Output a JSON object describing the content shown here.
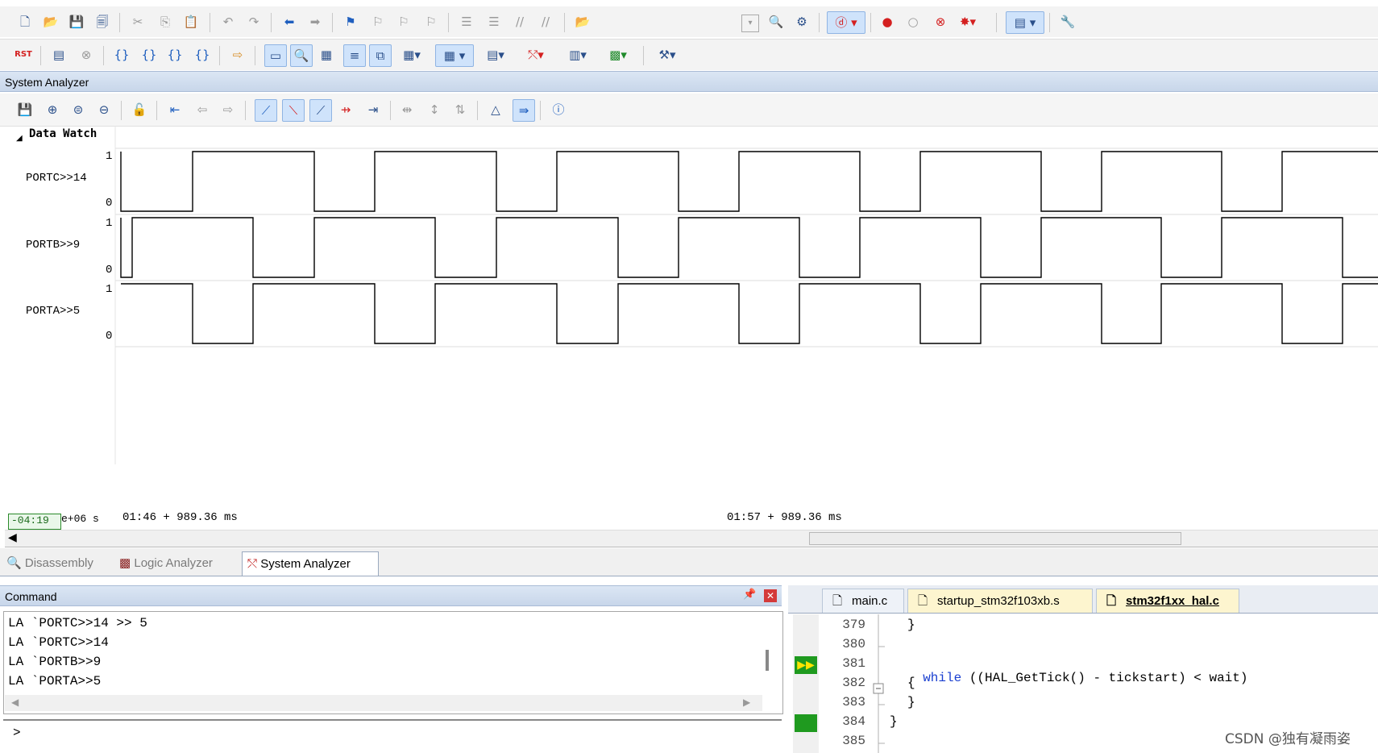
{
  "analyzer": {
    "panel_title": "System Analyzer",
    "group_label": "Data Watch",
    "signals": [
      {
        "name": "PORTC>>14",
        "high_label": "1",
        "low_label": "0"
      },
      {
        "name": "PORTB>>9",
        "high_label": "1",
        "low_label": "0"
      },
      {
        "name": "PORTA>>5",
        "high_label": "1",
        "low_label": "0"
      }
    ],
    "status": {
      "cursor_time": "-04:19",
      "scale": "e+06 s",
      "time_left": "01:46 + 989.36 ms",
      "time_right": "01:57 + 989.36 ms"
    }
  },
  "bottom_tabs": [
    {
      "label": "Disassembly",
      "active": false
    },
    {
      "label": "Logic Analyzer",
      "active": false
    },
    {
      "label": "System Analyzer",
      "active": true
    }
  ],
  "command": {
    "title": "Command",
    "lines": [
      "LA `PORTC>>14 >> 5",
      "LA `PORTC>>14",
      "LA `PORTB>>9",
      "LA `PORTA>>5"
    ],
    "prompt": ">",
    "pin_icon": "pin-icon",
    "close_icon": "close-icon"
  },
  "editor": {
    "tabs": [
      {
        "label": "main.c",
        "active": false
      },
      {
        "label": "startup_stm32f103xb.s",
        "active": false
      },
      {
        "label": "stm32f1xx_hal.c",
        "active": true
      }
    ],
    "lines": [
      {
        "no": "379",
        "code": "}",
        "indent": 1
      },
      {
        "no": "380",
        "code": "",
        "indent": 0
      },
      {
        "no": "381",
        "code_keyword": "while",
        "code_rest": " ((HAL_GetTick() - tickstart) < wait)",
        "indent": 1
      },
      {
        "no": "382",
        "code": "{",
        "indent": 1
      },
      {
        "no": "383",
        "code": "}",
        "indent": 1
      },
      {
        "no": "384",
        "code": "}",
        "indent": 0
      },
      {
        "no": "385",
        "code": "",
        "indent": 0
      }
    ]
  },
  "watermark": "CSDN @独有凝雨姿"
}
